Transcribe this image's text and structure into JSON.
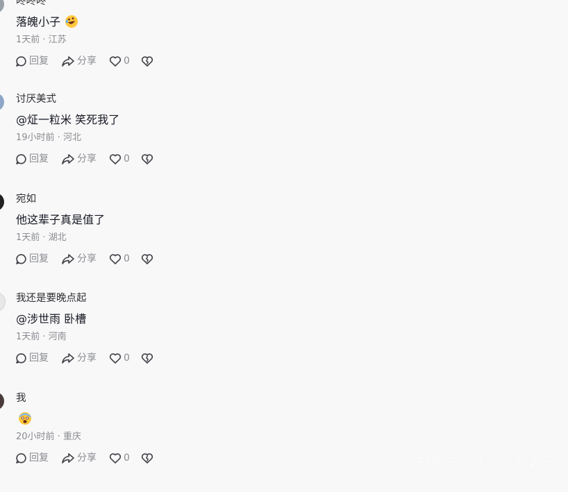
{
  "comments": [
    {
      "username": "咚咚咚",
      "text": "落魄小子",
      "emoji": "rofl-emoji",
      "meta": "1天前 · 江苏",
      "reply": "回复",
      "share": "分享",
      "likes": "0",
      "avatar_color": "#9aa0a8"
    },
    {
      "username": "讨厌美式",
      "text": "@炡一粒米  笑死我了",
      "emoji": "",
      "meta": "19小时前 · 河北",
      "reply": "回复",
      "share": "分享",
      "likes": "0",
      "avatar_color": "#8ea6c7"
    },
    {
      "username": "宛如",
      "text": "他这辈子真是值了",
      "emoji": "",
      "meta": "1天前 · 湖北",
      "reply": "回复",
      "share": "分享",
      "likes": "0",
      "avatar_color": "#222222"
    },
    {
      "username": "我还是要晚点起",
      "text": "@涉世雨  卧槽",
      "emoji": "",
      "meta": "1天前 · 河南",
      "reply": "回复",
      "share": "分享",
      "likes": "0",
      "avatar_color": "#e8e8e8"
    },
    {
      "username": "我",
      "text": "",
      "emoji": "scream-emoji",
      "meta": "20小时前 · 重庆",
      "reply": "回复",
      "share": "分享",
      "likes": "0",
      "avatar_color": "#4a3a3a"
    }
  ],
  "watermark": "快传号 / 尤岚聊娱乐",
  "colors": {
    "text": "#161823",
    "muted": "#8a8b91",
    "background": "#f8f8f8"
  }
}
